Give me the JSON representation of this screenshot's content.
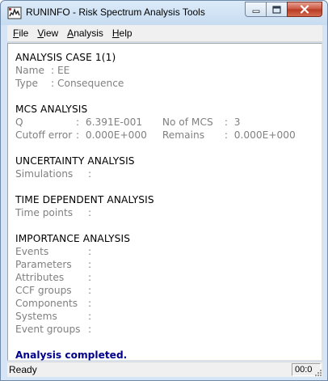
{
  "window": {
    "title": "RUNINFO - Risk Spectrum Analysis Tools",
    "icon": "app-icon",
    "controls": [
      "minimize-icon",
      "maximize-icon",
      "close-icon"
    ]
  },
  "menu": {
    "items": [
      "File",
      "View",
      "Analysis",
      "Help"
    ]
  },
  "report": {
    "analysis_case": {
      "title": "ANALYSIS CASE 1(1)",
      "name_label": "Name",
      "name_value": "EE",
      "type_label": "Type",
      "type_value": "Consequence"
    },
    "mcs": {
      "title": "MCS ANALYSIS",
      "q_label": "Q",
      "q_value": "6.391E-001",
      "no_mcs_label": "No of MCS",
      "no_mcs_value": "3",
      "cutoff_label": "Cutoff error",
      "cutoff_value": "0.000E+000",
      "remains_label": "Remains",
      "remains_value": "0.000E+000"
    },
    "uncertainty": {
      "title": "UNCERTAINTY ANALYSIS",
      "simulations_label": "Simulations"
    },
    "time_dependent": {
      "title": "TIME DEPENDENT ANALYSIS",
      "time_points_label": "Time points"
    },
    "importance": {
      "title": "IMPORTANCE ANALYSIS",
      "rows": [
        "Events",
        "Parameters",
        "Attributes",
        "CCF groups",
        "Components",
        "Systems",
        "Event groups"
      ]
    },
    "completion": "Analysis completed."
  },
  "status": {
    "text": "Ready",
    "panel": "00:0"
  },
  "colors": {
    "completion_text": "#00008b",
    "field_text": "#808080"
  }
}
